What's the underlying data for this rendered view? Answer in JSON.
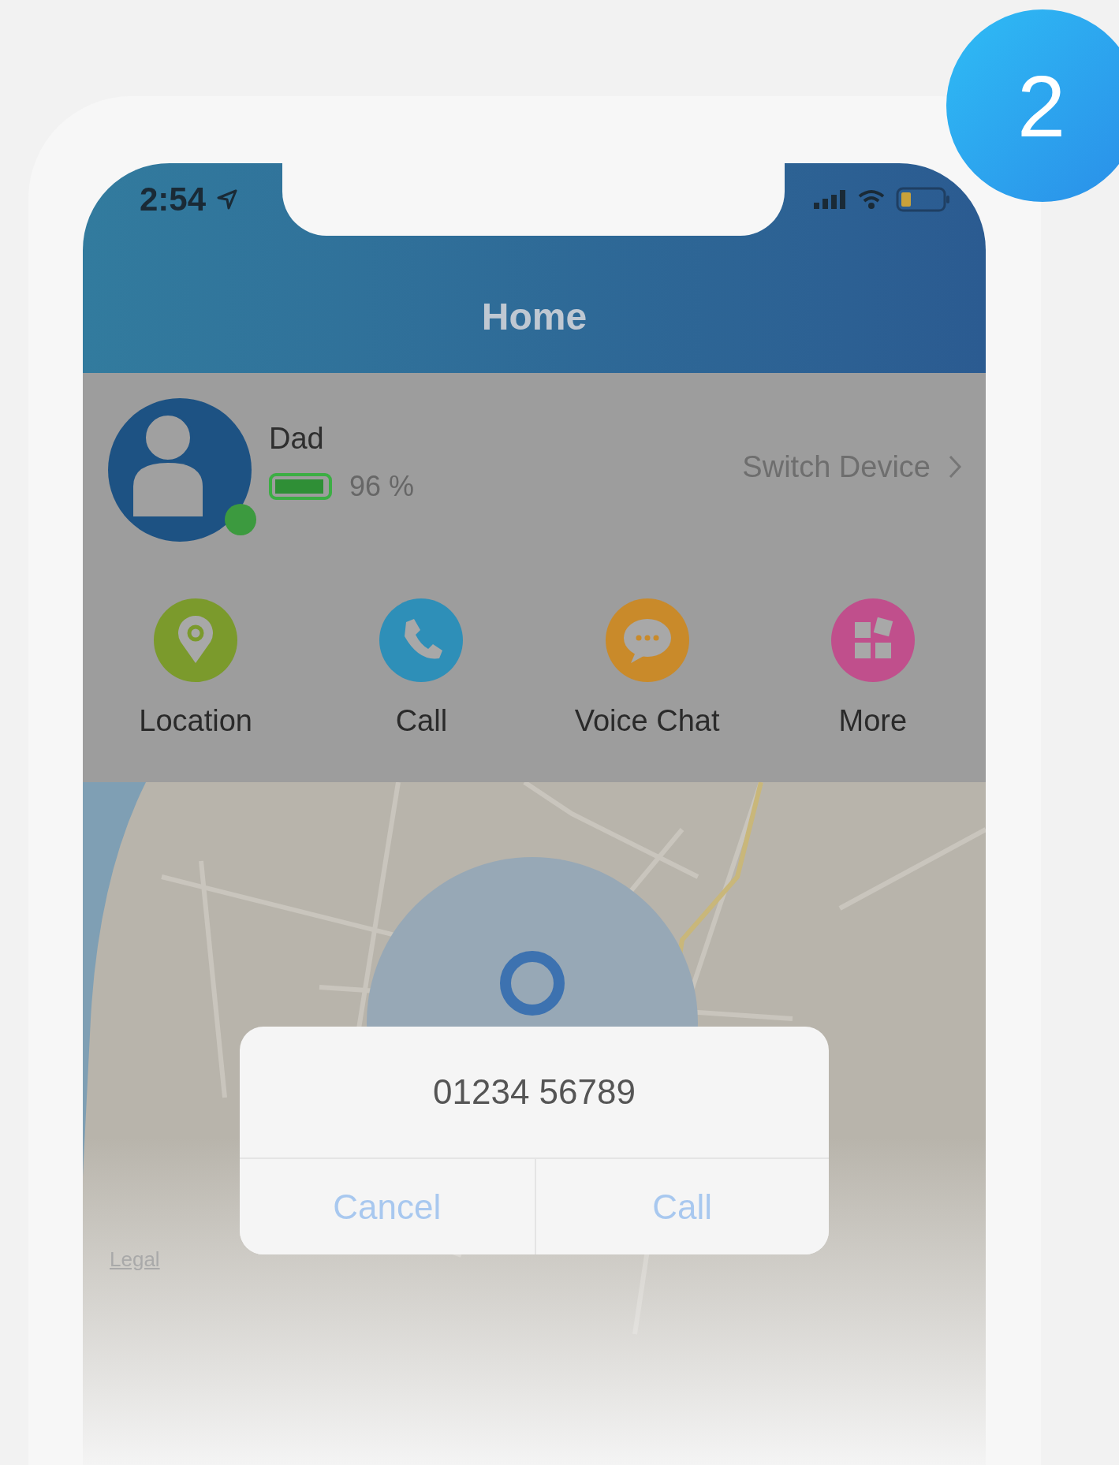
{
  "badge": "2",
  "status_bar": {
    "time": "2:54"
  },
  "header": {
    "title": "Home"
  },
  "device": {
    "name": "Dad",
    "online": true,
    "battery": {
      "level": 0.96,
      "reading": "96 %"
    },
    "switch_label": "Switch Device"
  },
  "actions": [
    {
      "kind": "location",
      "label": "Location",
      "color": "#7b9a2c"
    },
    {
      "kind": "call",
      "label": "Call",
      "color": "#2e8fb8"
    },
    {
      "kind": "chat",
      "label": "Voice Chat",
      "color": "#c98a2a"
    },
    {
      "kind": "more",
      "label": "More",
      "color": "#c04f8c"
    }
  ],
  "map": {
    "legal": "Legal"
  },
  "dialog": {
    "number": "01234 56789",
    "buttons": [
      {
        "label": "Cancel"
      },
      {
        "label": "Call"
      }
    ]
  }
}
